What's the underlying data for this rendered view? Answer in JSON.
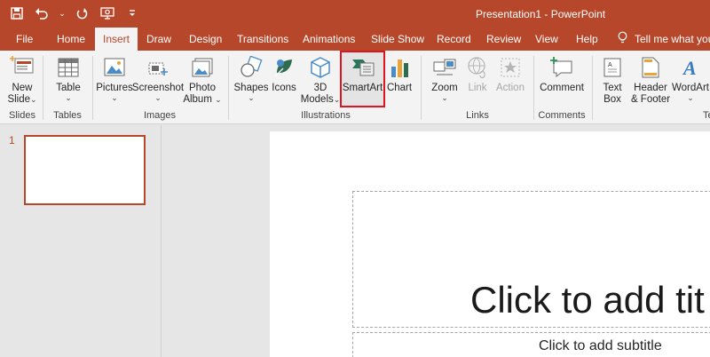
{
  "app": {
    "title": "Presentation1  -  PowerPoint",
    "accent_color": "#b7472a",
    "highlight_color": "#e0141e"
  },
  "qat": {
    "icons": [
      "save-icon",
      "undo-icon",
      "redo-icon",
      "present-icon",
      "customize-icon"
    ],
    "undo_dropdown": "⌄"
  },
  "tabs": [
    {
      "label": "File"
    },
    {
      "label": "Home"
    },
    {
      "label": "Insert",
      "active": true
    },
    {
      "label": "Draw"
    },
    {
      "label": "Design"
    },
    {
      "label": "Transitions"
    },
    {
      "label": "Animations"
    },
    {
      "label": "Slide Show"
    },
    {
      "label": "Record"
    },
    {
      "label": "Review"
    },
    {
      "label": "View"
    },
    {
      "label": "Help"
    }
  ],
  "tellme": {
    "label": "Tell me what you"
  },
  "ribbon": {
    "new_slide": {
      "line1": "New",
      "line2": "Slide",
      "chev": "⌄"
    },
    "table": {
      "label": "Table",
      "chev": "⌄"
    },
    "pictures": {
      "label": "Pictures",
      "chev": "⌄"
    },
    "screenshot": {
      "label": "Screenshot",
      "chev": "⌄"
    },
    "photo_album": {
      "line1": "Photo",
      "line2": "Album",
      "chev": "⌄"
    },
    "shapes": {
      "label": "Shapes",
      "chev": "⌄"
    },
    "icons": {
      "label": "Icons"
    },
    "models3d": {
      "line1": "3D",
      "line2": "Models",
      "chev": "⌄"
    },
    "smartart": {
      "label": "SmartArt"
    },
    "chart": {
      "label": "Chart"
    },
    "zoom": {
      "label": "Zoom",
      "chev": "⌄"
    },
    "link": {
      "label": "Link"
    },
    "action": {
      "label": "Action"
    },
    "comment": {
      "label": "Comment"
    },
    "textbox": {
      "line1": "Text",
      "line2": "Box"
    },
    "header_footer": {
      "line1": "Header",
      "line2": "& Footer"
    },
    "wordart": {
      "label": "WordArt",
      "chev": "⌄"
    },
    "groups": {
      "slides": "Slides",
      "tables": "Tables",
      "images": "Images",
      "illustrations": "Illustrations",
      "links": "Links",
      "comments": "Comments",
      "text": "Tex"
    }
  },
  "slides_panel": {
    "slide_number": "1"
  },
  "slide": {
    "title_placeholder": "Click to add tit",
    "subtitle_placeholder": "Click to add subtitle"
  }
}
